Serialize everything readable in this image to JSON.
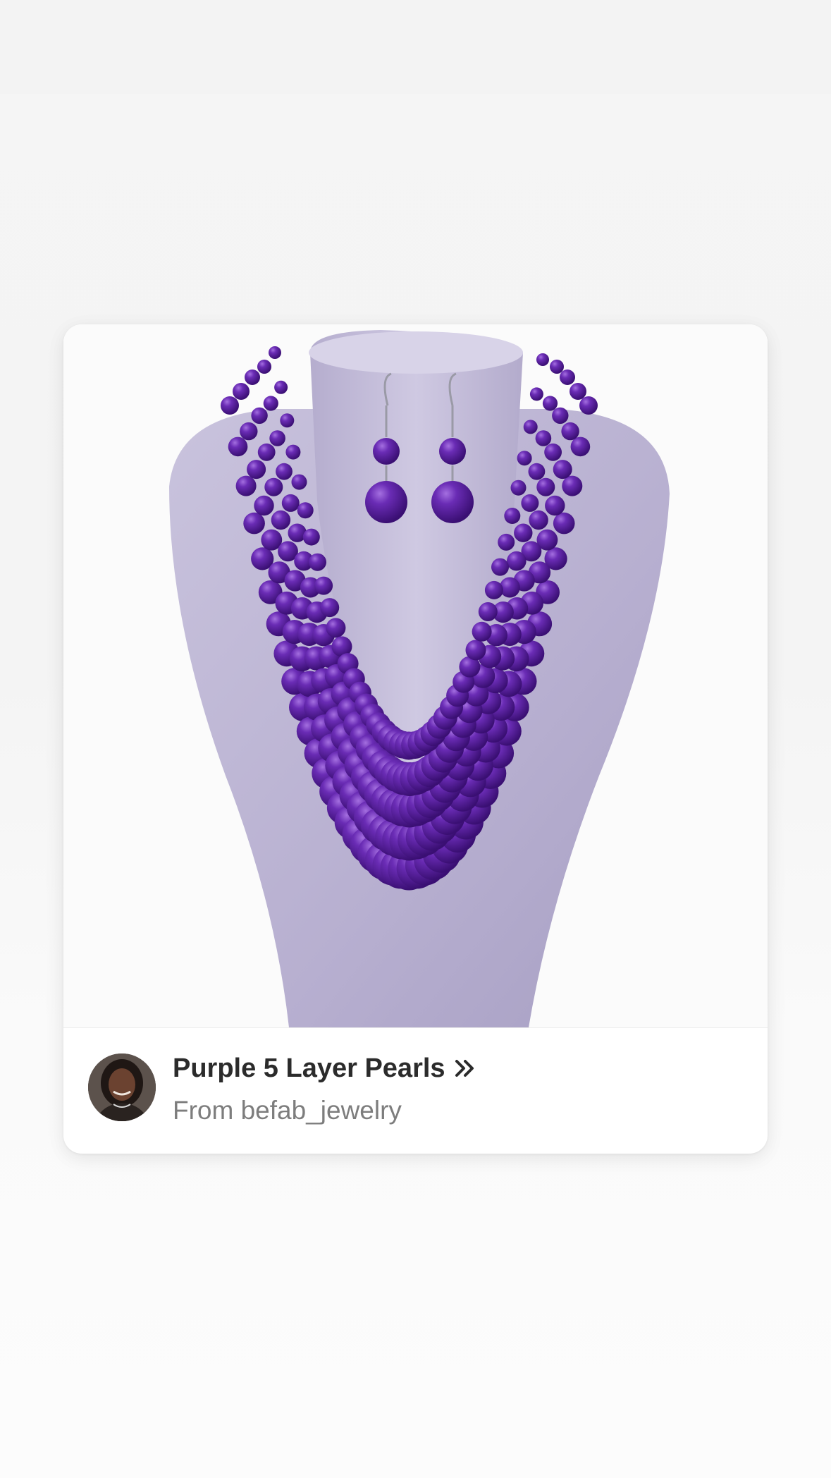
{
  "product": {
    "title": "Purple 5 Layer Pearls",
    "source": "From befab_jewelry",
    "image_icon": "necklace-photo",
    "accent_color": "#5b1f9e"
  },
  "icons": {
    "more": "double-chevron-right-icon",
    "avatar": "user-avatar"
  }
}
